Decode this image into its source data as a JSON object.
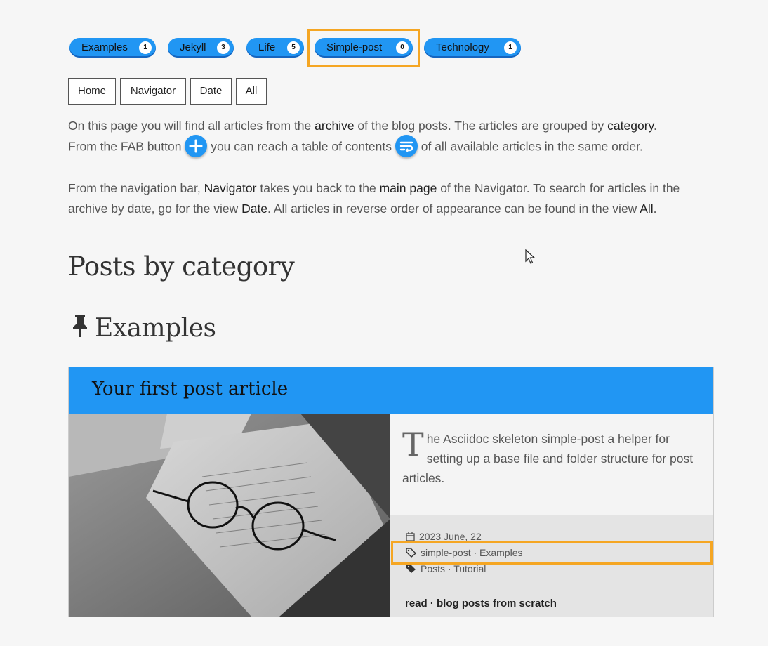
{
  "tags": [
    {
      "label": "Examples",
      "count": "1"
    },
    {
      "label": "Jekyll",
      "count": "3"
    },
    {
      "label": "Life",
      "count": "5"
    },
    {
      "label": "Simple-post",
      "count": "0"
    },
    {
      "label": "Technology",
      "count": "1"
    }
  ],
  "nav": [
    "Home",
    "Navigator",
    "Date",
    "All"
  ],
  "intro": {
    "p1_a": "On this page you will find all articles from the ",
    "p1_b": "archive",
    "p1_c": " of the blog posts. The articles are grouped by ",
    "p1_d": "category",
    "p1_e": ".",
    "p1_f": "From the FAB button ",
    "p1_g": " you can reach a table of contents ",
    "p1_h": " of all available articles in the same order.",
    "p2_a": "From the navigation bar, ",
    "p2_b": "Navigator",
    "p2_c": " takes you back to the ",
    "p2_d": "main page",
    "p2_e": " of the Navigator. To search for articles in the archive by date, go for the view ",
    "p2_f": "Date",
    "p2_g": ". All articles in reverse order of appearance can be found in the view ",
    "p2_h": "All",
    "p2_i": "."
  },
  "heading": "Posts by category",
  "category": "Examples",
  "card": {
    "title": "Your first post article",
    "dropcap": "T",
    "excerpt": "he Asciidoc skeleton simple-post a helper for setting up a base file and folder structure for post articles.",
    "date": "2023 June, 22",
    "tags": "simple-post · Examples",
    "categories": "Posts · Tutorial",
    "read": "read · blog posts from scratch"
  },
  "colors": {
    "accent": "#2196f3",
    "highlight": "#f5a623"
  }
}
